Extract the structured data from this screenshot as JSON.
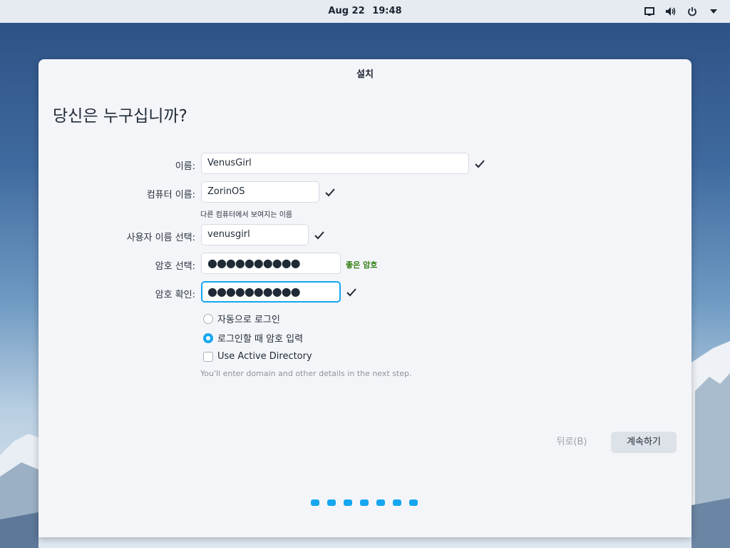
{
  "topbar": {
    "date": "Aug 22",
    "time": "19:48"
  },
  "window": {
    "title": "설치"
  },
  "page": {
    "heading": "당신은 누구십니까?"
  },
  "form": {
    "name": {
      "label": "이름:",
      "value": "VenusGirl"
    },
    "computer": {
      "label": "컴퓨터 이름:",
      "value": "ZorinOS",
      "hint": "다른 컴퓨터에서 보여지는 이름"
    },
    "username": {
      "label": "사용자 이름 선택:",
      "value": "venusgirl"
    },
    "password": {
      "label": "암호 선택:",
      "value": "●●●●●●●●●●",
      "strength": "좋은 암호"
    },
    "confirm": {
      "label": "암호 확인:",
      "value": "●●●●●●●●●●"
    }
  },
  "options": {
    "auto_login": "자동으로 로그인",
    "require_password": "로그인할 때 암호 입력",
    "active_directory": "Use Active Directory",
    "ad_note": "You'll enter domain and other details in the next step."
  },
  "buttons": {
    "back": "뒤로(B)",
    "next": "계속하기"
  },
  "icons": {
    "screen": "screen-icon",
    "volume": "volume-icon",
    "power": "power-icon",
    "menu": "dropdown-arrow-icon",
    "valid": "checkmark-icon"
  },
  "colors": {
    "accent": "#15a6f0",
    "strength": "#2f7d0f"
  }
}
